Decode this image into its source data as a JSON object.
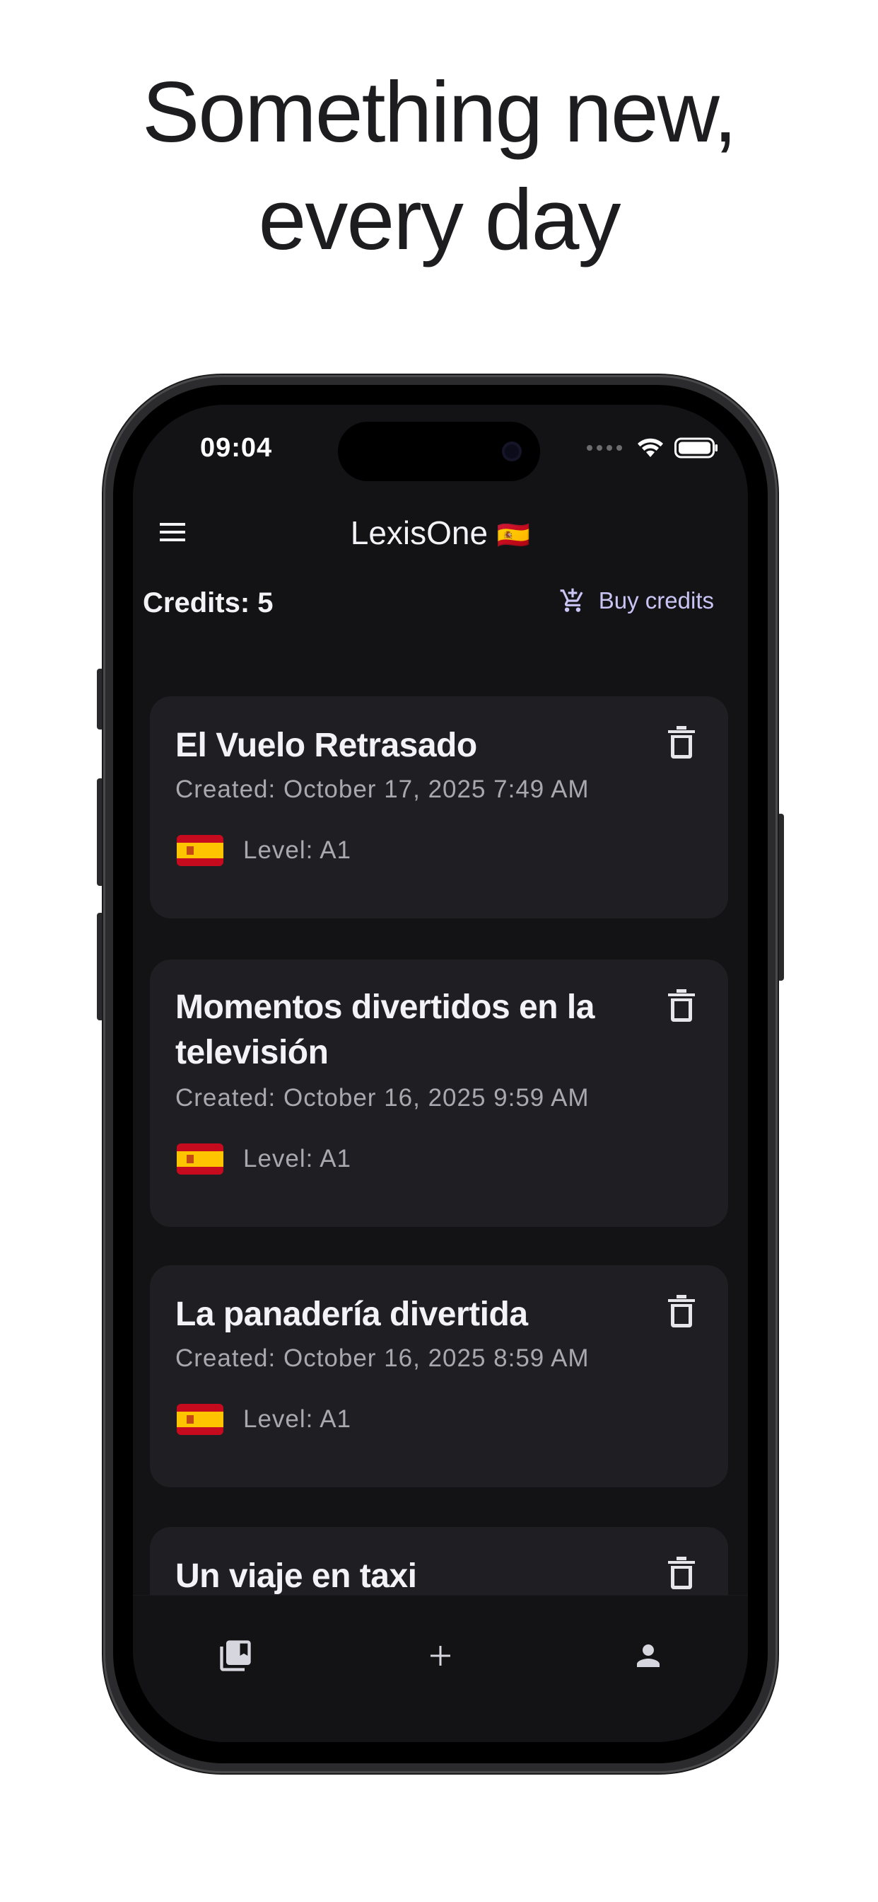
{
  "headline": {
    "line1": "Something new,",
    "line2": "every day"
  },
  "status_bar": {
    "time": "09:04"
  },
  "app_bar": {
    "title": "LexisOne",
    "flag": "🇪🇸"
  },
  "credits": {
    "label": "Credits: 5",
    "buy_label": "Buy credits"
  },
  "stories": [
    {
      "title": "El Vuelo Retrasado",
      "created": "Created: October 17, 2025 7:49 AM",
      "level": "Level: A1"
    },
    {
      "title": "Momentos divertidos en la televisión",
      "created": "Created: October 16, 2025 9:59 AM",
      "level": "Level: A1"
    },
    {
      "title": "La panadería divertida",
      "created": "Created: October 16, 2025 8:59 AM",
      "level": "Level: A1"
    },
    {
      "title": "Un viaje en taxi"
    }
  ],
  "bottom_nav": {
    "items": [
      {
        "icon": "library-icon"
      },
      {
        "icon": "add-icon"
      },
      {
        "icon": "profile-icon"
      }
    ]
  },
  "colors": {
    "background": "#131316",
    "card": "#1f1f23",
    "accent": "#c9c4f4",
    "text_primary": "#f2f2f7",
    "text_secondary": "#a8a8ae"
  }
}
